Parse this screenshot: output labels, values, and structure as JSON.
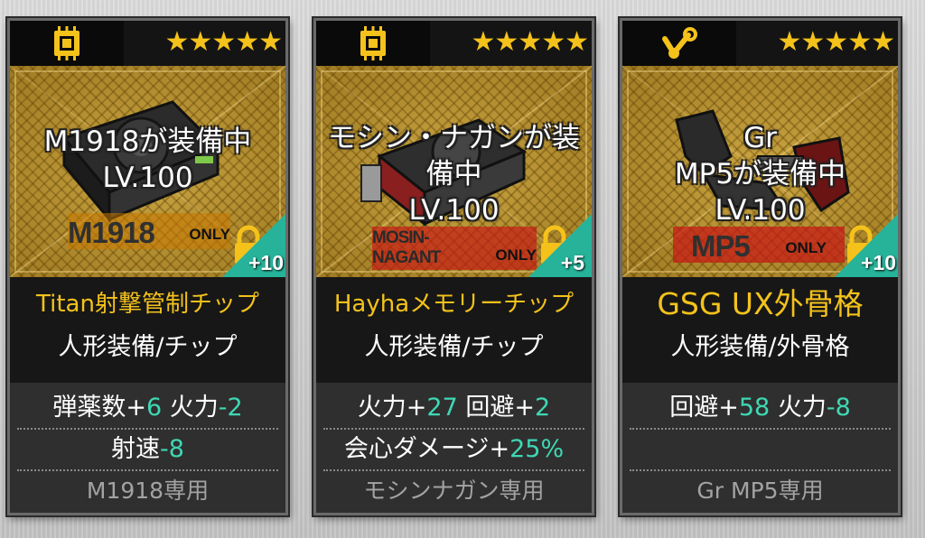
{
  "cards": [
    {
      "stars": "★★★★★",
      "type_icon": "chip-icon",
      "equipped_lines": [
        "M1918が装備中",
        "LV.100"
      ],
      "only_name": "M1918",
      "only_word": "ONLY",
      "plus": "+10",
      "name": "Titan射撃管制チップ",
      "type": "人形装備/チップ",
      "stats": {
        "row1": {
          "a_label": "弾薬数+",
          "a_value": "6",
          "b_label": "火力",
          "b_value": "-2"
        },
        "row2": {
          "a_label": "射速",
          "a_value": "-8"
        }
      },
      "exclusive": "M1918専用"
    },
    {
      "stars": "★★★★★",
      "type_icon": "chip-icon",
      "equipped_lines": [
        "モシン・ナガンが装",
        "備中",
        "LV.100"
      ],
      "only_name_1": "MOSIN-",
      "only_name_2": "NAGANT",
      "only_word": "ONLY",
      "plus": "+5",
      "name": "Hayhaメモリーチップ",
      "type": "人形装備/チップ",
      "stats": {
        "row1": {
          "a_label": "火力+",
          "a_value": "27",
          "b_label": "回避+",
          "b_value": "2"
        },
        "row2": {
          "a_label": "会心ダメージ+",
          "a_value": "25%"
        }
      },
      "exclusive": "モシンナガン専用"
    },
    {
      "stars": "★★★★★",
      "type_icon": "exoskeleton-icon",
      "equipped_lines": [
        "Gr",
        "MP5が装備中",
        "LV.100"
      ],
      "only_name": "MP5",
      "only_word": "ONLY",
      "plus": "+10",
      "name": "GSG UX外骨格",
      "type": "人形装備/外骨格",
      "stats": {
        "row1": {
          "a_label": "回避+",
          "a_value": "58",
          "b_label": "火力",
          "b_value": "-8"
        }
      },
      "exclusive": "Gr MP5専用"
    }
  ],
  "colors": {
    "star": "#f4c21b",
    "name": "#f4c21b",
    "stat_value": "#3fd7b3",
    "plus_badge": "#26b39a",
    "art_bg": "#b8922e"
  }
}
